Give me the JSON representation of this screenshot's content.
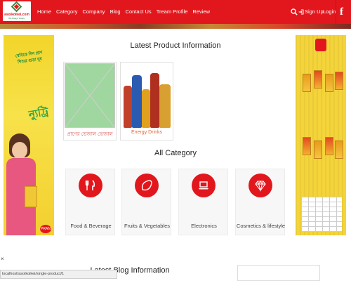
{
  "header": {
    "logo_text": "asoikoikei.com",
    "logo_tagline": "Be Always Happy",
    "nav": [
      "Home",
      "Category",
      "Company",
      "Blog",
      "Contact Us",
      "Tream Profile",
      "Review"
    ],
    "signup_label": "Sign Up",
    "login_label": "Login",
    "facebook_icon": "f",
    "brand_color": "#e2171d"
  },
  "ads": {
    "left_text": "বেবিকে দিন প্রাণ শিশুর গুড়া দুধ",
    "left_brand": "ন্যুট্রি",
    "left_logo": "PRAN"
  },
  "latest_products": {
    "title": "Latest Product Information",
    "items": [
      {
        "label": "প্রাণের ভেজাল ভেজাল",
        "image": "placeholder-image"
      },
      {
        "label": "Energy Drinks",
        "image": "bottles-image"
      }
    ]
  },
  "all_category": {
    "title": "All Category",
    "items": [
      {
        "label": "Food & Beverage",
        "icon": "fork-knife-icon"
      },
      {
        "label": "Fruits & Vegetables",
        "icon": "lemon-icon"
      },
      {
        "label": "Electronics",
        "icon": "laptop-icon"
      },
      {
        "label": "Cosmetics & lifestyle",
        "icon": "diamond-icon"
      }
    ]
  },
  "latest_blog": {
    "title": "Latest Blog Information"
  },
  "status_bar": {
    "url": "localhost/asoikoikei/single-product/1"
  },
  "close_label": "×"
}
